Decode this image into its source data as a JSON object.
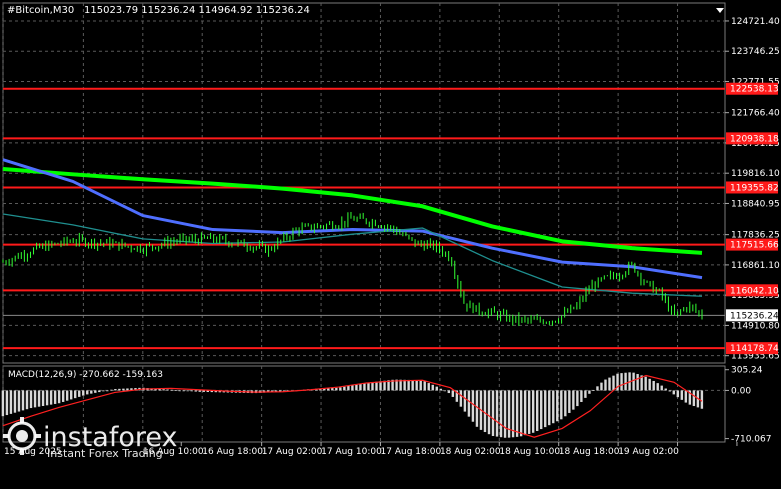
{
  "chart_data": [
    {
      "type": "candlestick",
      "header": {
        "symbol": "#Bitcoin,M30",
        "values": "115023.79 115236.24 114964.92 115236.24"
      },
      "y_ticks": [
        "124721.40",
        "123746.25",
        "122771.55",
        "121766.40",
        "120791.25",
        "119816.10",
        "118840.95",
        "117836.25",
        "116861.10",
        "115885.95",
        "114910.80",
        "113935.65"
      ],
      "x_ticks": [
        "15 Aug 2025",
        "16 Aug 10:00",
        "16 Aug 18:00",
        "17 Aug 02:00",
        "17 Aug 10:00",
        "17 Aug 18:00",
        "18 Aug 02:00",
        "18 Aug 10:00",
        "18 Aug 18:00",
        "19 Aug 02:00"
      ],
      "ylim": [
        113700,
        125300
      ],
      "levels": [
        {
          "label": "122538.13",
          "value": 122538.13
        },
        {
          "label": "120938.18",
          "value": 120938.18
        },
        {
          "label": "119355.82",
          "value": 119355.82
        },
        {
          "label": "117515.66",
          "value": 117515.66
        },
        {
          "label": "116042.10",
          "value": 116042.1
        },
        {
          "label": "114178.74",
          "value": 114178.74
        }
      ],
      "current_price": {
        "label": "115236.24",
        "value": 115236.24
      },
      "series": [
        {
          "color": "#00ff00",
          "x": [
            0,
            0.1,
            0.2,
            0.3,
            0.4,
            0.5,
            0.6,
            0.7,
            0.8,
            0.9,
            1.0
          ],
          "values": [
            119950,
            119780,
            119620,
            119480,
            119320,
            119100,
            118750,
            118100,
            117620,
            117400,
            117250
          ]
        },
        {
          "color": "#4f6fff",
          "x": [
            0,
            0.1,
            0.2,
            0.3,
            0.4,
            0.5,
            0.6,
            0.7,
            0.8,
            0.9,
            1.0
          ],
          "values": [
            120250,
            119550,
            118450,
            118000,
            117900,
            118000,
            117950,
            117400,
            116950,
            116800,
            116450
          ]
        },
        {
          "color": "#1f8f8f",
          "x": [
            0,
            0.1,
            0.2,
            0.3,
            0.4,
            0.5,
            0.6,
            0.7,
            0.8,
            0.9,
            1.0
          ],
          "values": [
            118500,
            118150,
            117700,
            117550,
            117600,
            117850,
            118050,
            117000,
            116150,
            115950,
            115850
          ]
        }
      ],
      "price_path": {
        "x": [
          0,
          0.05,
          0.1,
          0.15,
          0.2,
          0.25,
          0.3,
          0.35,
          0.38,
          0.42,
          0.45,
          0.48,
          0.5,
          0.53,
          0.56,
          0.59,
          0.62,
          0.64,
          0.66,
          0.68,
          0.7,
          0.73,
          0.76,
          0.79,
          0.82,
          0.84,
          0.86,
          0.88,
          0.9,
          0.92,
          0.94,
          0.96,
          0.98,
          1.0
        ],
        "values": [
          116950,
          117400,
          117650,
          117550,
          117400,
          117650,
          117700,
          117500,
          117350,
          118000,
          118100,
          118200,
          118350,
          118250,
          118000,
          117550,
          117450,
          117100,
          115600,
          115400,
          115300,
          115100,
          115050,
          115100,
          115500,
          116150,
          116400,
          116550,
          116850,
          116250,
          115950,
          115200,
          115550,
          115236
        ]
      }
    },
    {
      "type": "bar",
      "title": "MACD(12,26,9) -270.662 -159.163",
      "y_ticks": [
        "305.24",
        "0.00",
        "-710.067"
      ],
      "ylim": [
        -760,
        360
      ],
      "histogram": {
        "x": [
          0,
          0.04,
          0.08,
          0.12,
          0.16,
          0.2,
          0.24,
          0.28,
          0.32,
          0.36,
          0.4,
          0.44,
          0.48,
          0.52,
          0.56,
          0.6,
          0.62,
          0.64,
          0.66,
          0.68,
          0.7,
          0.72,
          0.74,
          0.76,
          0.78,
          0.8,
          0.82,
          0.84,
          0.86,
          0.88,
          0.9,
          0.92,
          0.94,
          0.96,
          0.98,
          1.0
        ],
        "values": [
          -380,
          -260,
          -190,
          -60,
          20,
          40,
          10,
          -20,
          -30,
          -40,
          -20,
          20,
          40,
          110,
          160,
          150,
          60,
          -50,
          -300,
          -560,
          -670,
          -700,
          -680,
          -620,
          -520,
          -420,
          -250,
          -40,
          150,
          250,
          270,
          200,
          90,
          -60,
          -200,
          -270
        ]
      },
      "signal": {
        "color": "#ff2020",
        "x": [
          0,
          0.04,
          0.08,
          0.12,
          0.16,
          0.2,
          0.24,
          0.28,
          0.32,
          0.36,
          0.4,
          0.44,
          0.48,
          0.52,
          0.56,
          0.6,
          0.64,
          0.68,
          0.72,
          0.76,
          0.8,
          0.84,
          0.88,
          0.92,
          0.96,
          1.0
        ],
        "values": [
          -520,
          -380,
          -250,
          -140,
          -30,
          20,
          30,
          10,
          -10,
          -25,
          -20,
          10,
          50,
          110,
          140,
          150,
          40,
          -260,
          -560,
          -690,
          -560,
          -300,
          60,
          220,
          120,
          -159
        ]
      }
    }
  ],
  "watermark": {
    "brand": "instaforex",
    "tagline": "Instant Forex Trading"
  }
}
